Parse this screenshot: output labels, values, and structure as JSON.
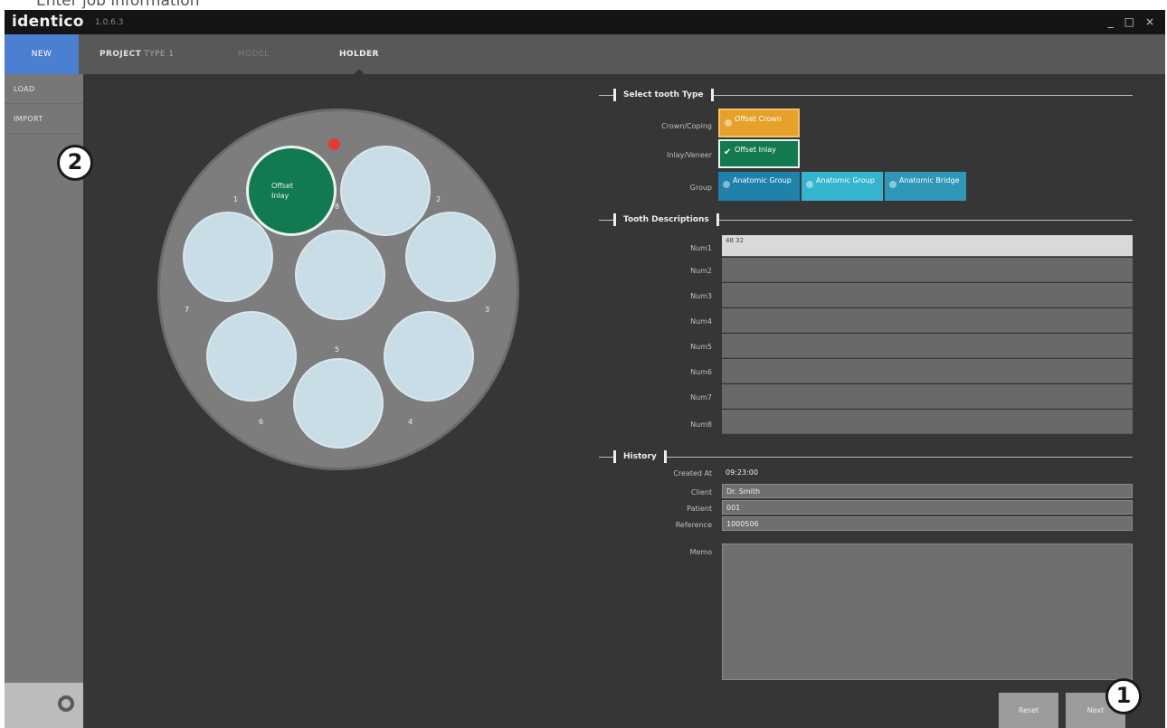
{
  "caption": "Enter job information",
  "app": {
    "name": "identico",
    "version": "1.0.6.3"
  },
  "window_controls": [
    "_",
    "□",
    "×"
  ],
  "toolbar": {
    "new_tab": "NEW",
    "project_label": "PROJECT",
    "project_value": "TYPE 1",
    "middle_tab": "MODEL",
    "active_tab": "HOLDER"
  },
  "sidebar": {
    "items": [
      "LOAD",
      "IMPORT"
    ],
    "settings_icon": "gear-icon"
  },
  "wheel": {
    "selected_label": "Offset Inlay",
    "slot_numbers": [
      "1",
      "2",
      "3",
      "4",
      "5",
      "6",
      "7",
      "8"
    ]
  },
  "form": {
    "select_tooth_type_title": "Select tooth Type",
    "crown_coping_label": "Crown/Coping",
    "inlay_veneer_label": "Inlay/Veneer",
    "group_label": "Group",
    "crown_coping_option": "Offset Crown",
    "inlay_option": "Offset Inlay",
    "group_options": [
      "Anatomic Group",
      "Anatomic Group",
      "Anatomic Bridge"
    ],
    "tooth_descriptions_title": "Tooth Descriptions",
    "desc_labels": [
      "Num1",
      "Num2",
      "Num3",
      "Num4",
      "Num5",
      "Num6",
      "Num7",
      "Num8"
    ],
    "desc_first_value": "48\n32",
    "history_title": "History",
    "history_labels": [
      "Created At",
      "Client",
      "Patient",
      "Reference",
      "Memo"
    ],
    "history_values": [
      "09:23:00",
      "Dr. Smith",
      "001",
      "1000506"
    ]
  },
  "buttons": {
    "reset": "Reset",
    "next": "Next"
  },
  "callouts": [
    "1",
    "2"
  ]
}
